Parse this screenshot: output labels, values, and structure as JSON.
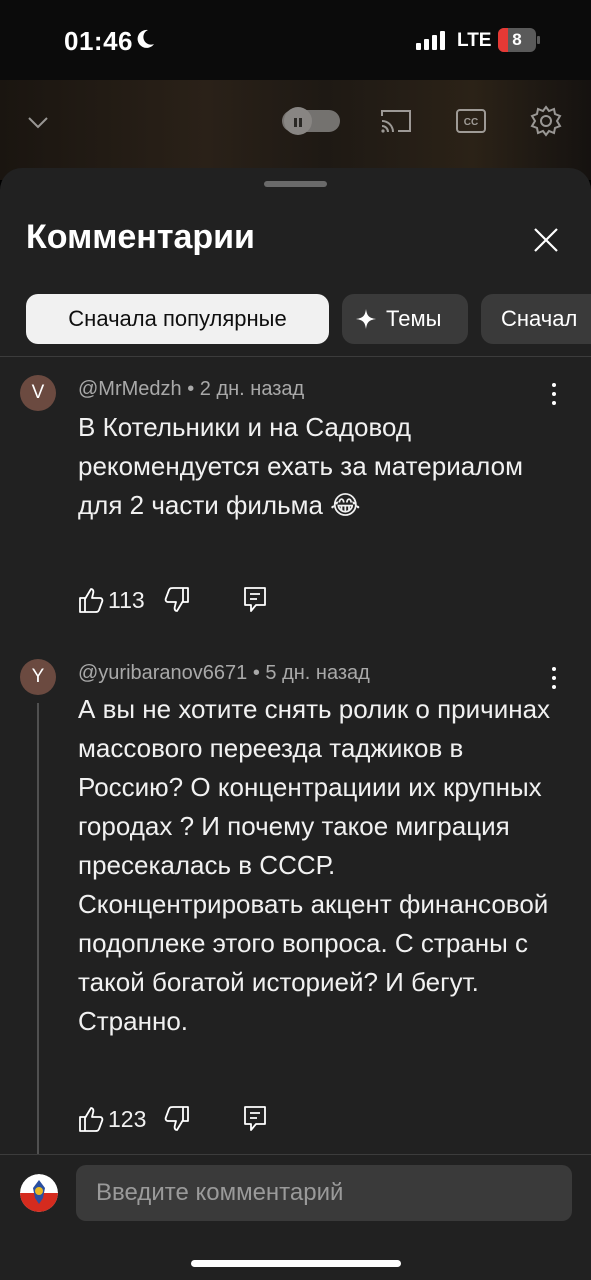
{
  "status_bar": {
    "time": "01:46",
    "network": "LTE",
    "battery": "8"
  },
  "sheet": {
    "title": "Комментарии",
    "chips": [
      {
        "label": "Сначала популярные",
        "active": true
      },
      {
        "label": "Темы",
        "icon": "sparkle-icon"
      },
      {
        "label": "Сначал"
      }
    ]
  },
  "comments": [
    {
      "avatar_letter": "V",
      "meta": "@MrMedzh • 2 дн. назад",
      "text": "В Котельники и на Садовод рекомендуется ехать за материалом для 2 части фильма 😂",
      "likes": "113"
    },
    {
      "avatar_letter": "Y",
      "meta": "@yuribaranov6671 • 5 дн. назад",
      "text": "А вы не хотите снять ролик о причинах массового переезда таджиков в Россию? О концентрациии их крупных городах ?  И почему такое миграция пресекалась в СССР. Сконцентрировать акцент финансовой подоплеке этого вопроса. С страны с такой богатой историей? И бегут. Странно.",
      "likes": "123"
    }
  ],
  "input": {
    "placeholder": "Введите комментарий"
  },
  "colors": {
    "sheet_bg": "#212121",
    "chip_active_bg": "#f1f1f1",
    "chip_bg": "#3a3a3a",
    "avatar_bg": "#6b4a40"
  }
}
